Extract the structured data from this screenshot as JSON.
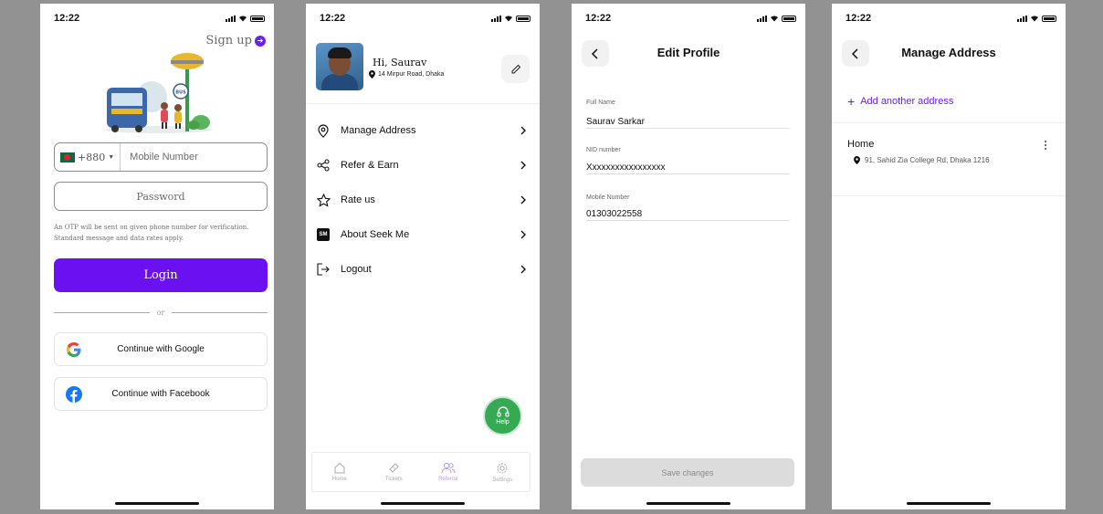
{
  "status_bar": {
    "time": "12:22"
  },
  "login": {
    "signup_label": "Sign up",
    "country_code": "+880",
    "mobile_placeholder": "Mobile Number",
    "password_placeholder": "Password",
    "otp_notice_line1": "An OTP will be sent on given phone number for verification.",
    "otp_notice_line2": "Standard message and data rates apply.",
    "login_label": "Login",
    "or_label": "or",
    "google_label": "Continue with Google",
    "facebook_label": "Continue with Facebook",
    "bus_sign_text": "BUS",
    "accent_color": "#6a10f1"
  },
  "profile": {
    "greeting": "Hi, Saurav",
    "address": "14 Mirpur Road, Dhaka",
    "menu": [
      {
        "label": "Manage Address",
        "icon": "location-pin-icon"
      },
      {
        "label": "Refer & Earn",
        "icon": "share-icon"
      },
      {
        "label": "Rate us",
        "icon": "star-icon"
      },
      {
        "label": "About Seek Me",
        "icon": "sm-logo-icon",
        "badge": "SM"
      },
      {
        "label": "Logout",
        "icon": "logout-icon"
      }
    ],
    "help_label": "Help",
    "tabs": [
      {
        "label": "Home",
        "icon": "home-icon"
      },
      {
        "label": "Tickets",
        "icon": "ticket-icon"
      },
      {
        "label": "Referral",
        "icon": "people-icon",
        "active": true
      },
      {
        "label": "Settings",
        "icon": "gear-icon"
      }
    ],
    "help_color": "#35a954"
  },
  "edit_profile": {
    "title": "Edit Profile",
    "fields": [
      {
        "label": "Full Name",
        "value": "Saurav Sarkar"
      },
      {
        "label": "NID number",
        "value": "Xxxxxxxxxxxxxxxxx"
      },
      {
        "label": "Mobile Number",
        "value": "01303022558"
      }
    ],
    "save_label": "Save changes"
  },
  "manage_address": {
    "title": "Manage Address",
    "add_label": "Add another address",
    "addresses": [
      {
        "title": "Home",
        "detail": "91, Sahid Zia College Rd, Dhaka 1216"
      }
    ]
  }
}
